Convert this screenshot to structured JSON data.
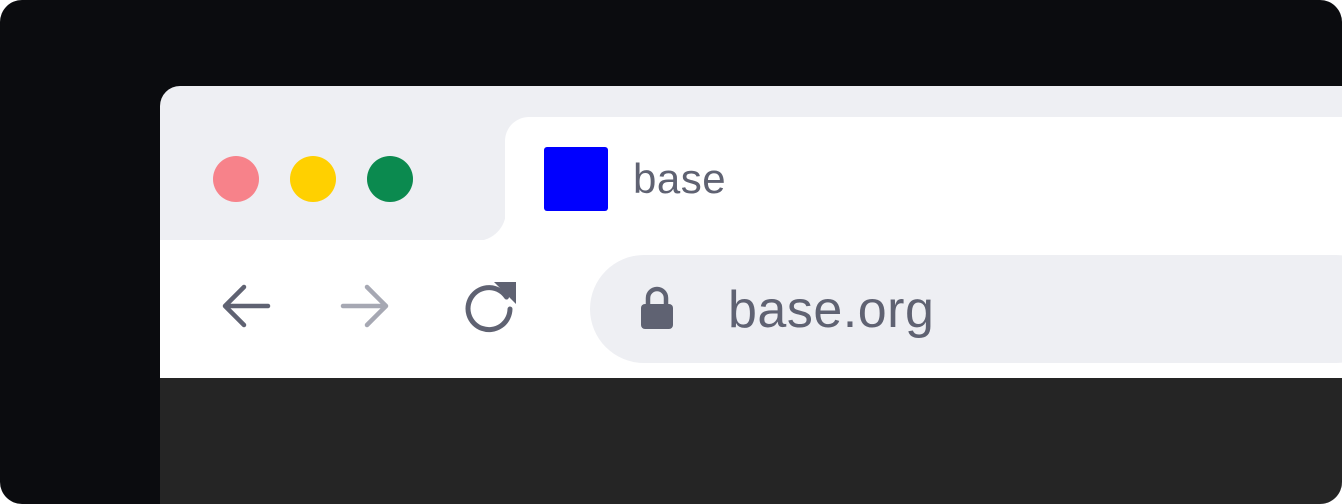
{
  "window": {
    "traffic_lights": [
      {
        "name": "close",
        "color": "#f7828a"
      },
      {
        "name": "minimize",
        "color": "#ffd000"
      },
      {
        "name": "maximize",
        "color": "#0b8a4f"
      }
    ]
  },
  "tab": {
    "title": "base",
    "favicon_color": "#0000ff"
  },
  "toolbar": {
    "back_icon": "arrow-left-icon",
    "forward_icon": "arrow-right-icon",
    "reload_icon": "reload-icon",
    "forward_enabled": false
  },
  "omnibox": {
    "lock_icon": "lock-icon",
    "url": "base.org"
  },
  "colors": {
    "chrome_bg": "#eeeff3",
    "icon": "#5f6272",
    "icon_disabled": "#a6a8b3",
    "content_bg": "#252525",
    "outer_bg": "#0b0c0f"
  }
}
